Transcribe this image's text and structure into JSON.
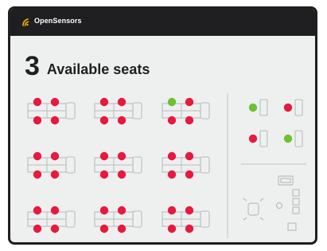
{
  "app": {
    "brand": "OpenSensors",
    "logo_icon": "wifi-signal-icon",
    "accent": "#f5b400"
  },
  "header": {
    "count": "3",
    "label": "Available seats"
  },
  "colors": {
    "occupied": "#e8193c",
    "available": "#6cc22f",
    "furniture_outline": "#b9bdbd",
    "divider": "#c8cccc",
    "frame": "#1f1f21"
  },
  "floor_plan": {
    "bench_clusters": [
      {
        "seats": [
          "occupied",
          "occupied",
          "occupied",
          "occupied"
        ]
      },
      {
        "seats": [
          "occupied",
          "occupied",
          "occupied",
          "occupied"
        ]
      },
      {
        "seats": [
          "available",
          "occupied",
          "occupied",
          "occupied"
        ]
      },
      {
        "seats": [
          "occupied",
          "occupied",
          "occupied",
          "occupied"
        ]
      },
      {
        "seats": [
          "occupied",
          "occupied",
          "occupied",
          "occupied"
        ]
      },
      {
        "seats": [
          "occupied",
          "occupied",
          "occupied",
          "occupied"
        ]
      },
      {
        "seats": [
          "occupied",
          "occupied",
          "occupied",
          "occupied"
        ]
      },
      {
        "seats": [
          "occupied",
          "occupied",
          "occupied",
          "occupied"
        ]
      },
      {
        "seats": [
          "occupied",
          "occupied",
          "occupied",
          "occupied"
        ]
      }
    ],
    "single_desks": [
      "available",
      "occupied",
      "occupied",
      "available"
    ],
    "lounge_icon": "meeting-lounge-icon"
  }
}
